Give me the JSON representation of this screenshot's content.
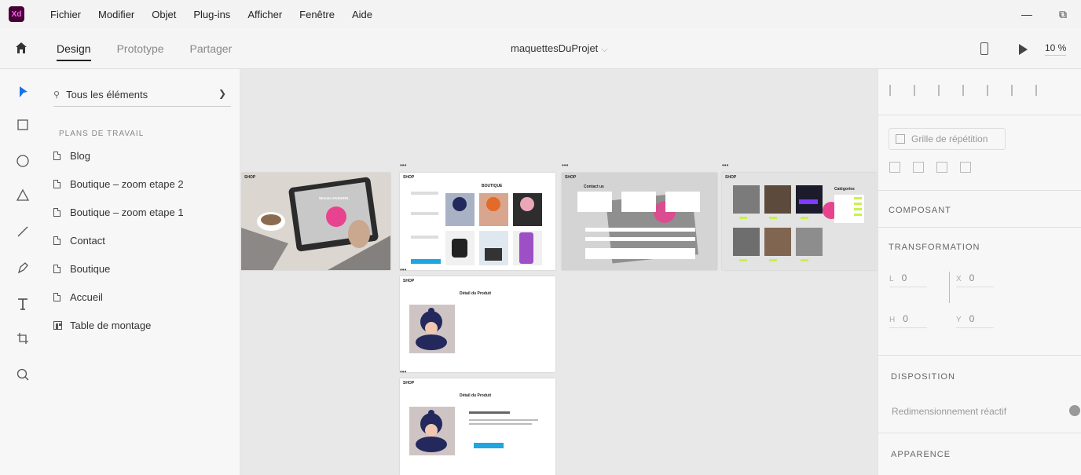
{
  "app": {
    "logo": "Xd"
  },
  "menu": [
    "Fichier",
    "Modifier",
    "Objet",
    "Plug-ins",
    "Afficher",
    "Fenêtre",
    "Aide"
  ],
  "window_controls": {
    "minimize": "—",
    "restore": "⧉"
  },
  "tabs": [
    {
      "label": "Design",
      "active": true
    },
    {
      "label": "Prototype",
      "active": false
    },
    {
      "label": "Partager",
      "active": false
    }
  ],
  "doc_title": "maquettesDuProjet",
  "doc_title_chevron": "⌵",
  "zoom": "10 %",
  "layers": {
    "search_value": "Tous les éléments",
    "section_label": "PLANS DE TRAVAIL",
    "items": [
      "Blog",
      "Boutique – zoom etape 2",
      "Boutique – zoom etape 1",
      "Contact",
      "Boutique",
      "Accueil",
      "Table de montage"
    ]
  },
  "artboards": {
    "accueil": {
      "nav": "SHOP",
      "hero": "Women FASHION"
    },
    "boutique": {
      "nav": "SHOP",
      "title": "BOUTIQUE",
      "dots": "•••"
    },
    "contact": {
      "nav": "SHOP",
      "title": "Contact us",
      "dots": "•••"
    },
    "blog": {
      "nav": "SHOP",
      "title": "Catégories",
      "dots": "•••"
    },
    "zoom1": {
      "nav": "SHOP",
      "title": "Détail du Produit",
      "dots": "•••"
    },
    "zoom2": {
      "nav": "SHOP",
      "title": "Détail du Produit",
      "dots": "•••"
    }
  },
  "properties": {
    "repeat_grid": "Grille de répétition",
    "component_label": "COMPOSANT",
    "transform_label": "TRANSFORMATION",
    "w_label": "L",
    "w_value": "0",
    "h_label": "H",
    "h_value": "0",
    "x_label": "X",
    "x_value": "0",
    "y_label": "Y",
    "y_value": "0",
    "layout_label": "DISPOSITION",
    "responsive_resize": "Redimensionnement réactif",
    "appearance_label": "APPARENCE"
  },
  "colors": {
    "accent_pink": "#e8438f",
    "cyan_button": "#1fa6e0",
    "xd_purple": "#470137"
  }
}
